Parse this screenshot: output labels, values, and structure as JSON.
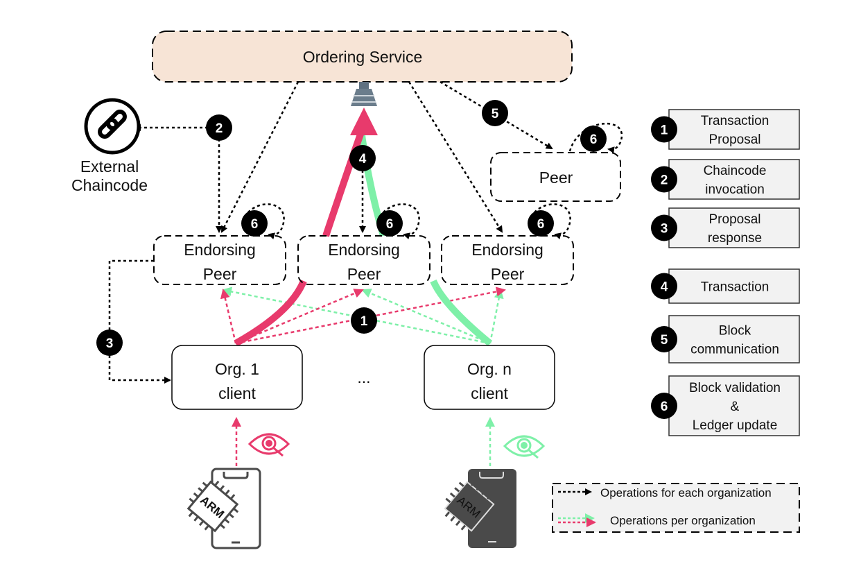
{
  "colors": {
    "pink": "#e83a6c",
    "green": "#7ef0a8",
    "ordering_fill": "#f7e4d6",
    "legend_fill": "#f2f2f2"
  },
  "ordering_service": {
    "label": "Ordering Service"
  },
  "external_chaincode": {
    "icon": "link-icon",
    "line1": "External",
    "line2": "Chaincode"
  },
  "peer": {
    "label": "Peer"
  },
  "endorsing_peers": [
    {
      "line1": "Endorsing",
      "line2": "Peer"
    },
    {
      "line1": "Endorsing",
      "line2": "Peer"
    },
    {
      "line1": "Endorsing",
      "line2": "Peer"
    }
  ],
  "clients": [
    {
      "line1": "Org. 1",
      "line2": "client"
    },
    {
      "line1": "Org. n",
      "line2": "client"
    }
  ],
  "ellipsis": "...",
  "badges": {
    "b1": "1",
    "b2": "2",
    "b3": "3",
    "b4": "4",
    "b5": "5",
    "b6": "6"
  },
  "legend_steps": [
    {
      "num": "1",
      "lines": [
        "Transaction",
        "Proposal"
      ]
    },
    {
      "num": "2",
      "lines": [
        "Chaincode",
        "invocation"
      ]
    },
    {
      "num": "3",
      "lines": [
        "Proposal",
        "response"
      ]
    },
    {
      "num": "4",
      "lines": [
        "Transaction"
      ]
    },
    {
      "num": "5",
      "lines": [
        "Block",
        "communication"
      ]
    },
    {
      "num": "6",
      "lines": [
        "Block validation",
        "&",
        "Ledger update"
      ]
    }
  ],
  "arrow_legend": {
    "each_org": "Operations for each organization",
    "per_org": "Operations per organization"
  },
  "devices": [
    {
      "icon": "arm-phone-icon",
      "chip": "ARM",
      "style": "outline"
    },
    {
      "icon": "arm-phone-icon",
      "chip": "ARM",
      "style": "filled"
    }
  ]
}
